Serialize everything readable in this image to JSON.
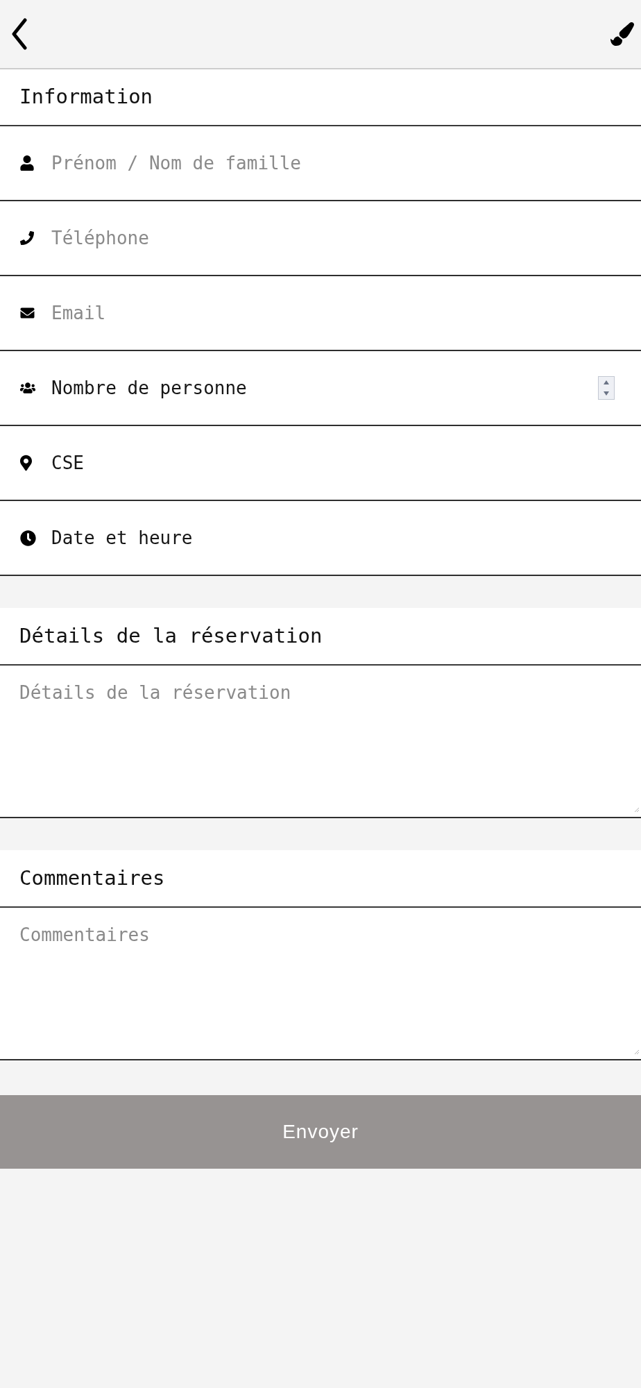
{
  "information": {
    "title": "Information",
    "fields": [
      {
        "kind": "text",
        "placeholder": "Prénom / Nom de famille"
      },
      {
        "kind": "text",
        "placeholder": "Téléphone"
      },
      {
        "kind": "text",
        "placeholder": "Email"
      },
      {
        "kind": "number",
        "placeholder": "Nombre de personne"
      },
      {
        "kind": "select",
        "label": "CSE"
      },
      {
        "kind": "select",
        "label": "Date et heure"
      }
    ]
  },
  "text_sections": [
    {
      "title": "Détails de la réservation",
      "placeholder": "Détails de la réservation"
    },
    {
      "title": "Commentaires",
      "placeholder": "Commentaires"
    }
  ],
  "submit_button": {
    "label": "Envoyer",
    "disabled": true
  }
}
